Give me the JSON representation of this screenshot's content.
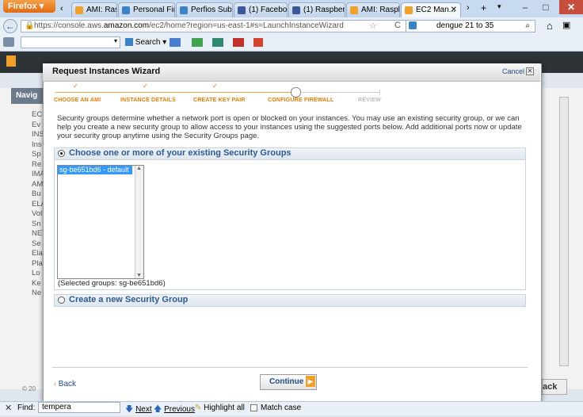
{
  "browser": {
    "menu_button": "Firefox",
    "tabs": [
      {
        "label": "AMI: Raspb...",
        "icon_color": "#f0a12a"
      },
      {
        "label": "Personal Fin...",
        "icon_color": "#3b83c8"
      },
      {
        "label": "Perfios Subs...",
        "icon_color": "#3b83c8"
      },
      {
        "label": "(1) Facebook",
        "icon_color": "#3b5998"
      },
      {
        "label": "(1) Raspberr...",
        "icon_color": "#3b5998"
      },
      {
        "label": "AMI: Raspb...",
        "icon_color": "#f0a12a"
      },
      {
        "label": "EC2 Man...",
        "icon_color": "#f0a12a"
      }
    ],
    "url_prefix": "https://console.aws.",
    "url_domain": "amazon.com",
    "url_rest": "/ec2/home?region=us-east-1#s=LaunchInstanceWizard",
    "search_text": "dengue 21 to 35",
    "toolbar_search": "Search"
  },
  "page": {
    "nav_heading": "Navig",
    "left_items": [
      "EC",
      "Ev",
      "INS",
      "Ins",
      "Sp",
      "Re",
      "IMA",
      "AM",
      "Bu",
      "ELA",
      "Vol",
      "Sn",
      "NET",
      "Se",
      "Ela",
      "Pla",
      "Lo",
      "Ke",
      "Ne"
    ],
    "right_partial": "ack",
    "footer_partial": "© 20"
  },
  "wizard": {
    "title": "Request Instances Wizard",
    "cancel": "Cancel",
    "steps": [
      {
        "label": "CHOOSE AN AMI",
        "done": true
      },
      {
        "label": "INSTANCE DETAILS",
        "done": true
      },
      {
        "label": "CREATE KEY PAIR",
        "done": true
      },
      {
        "label": "CONFIGURE FIREWALL",
        "current": true
      },
      {
        "label": "REVIEW",
        "future": true
      }
    ],
    "intro": "Security groups determine whether a network port is open or blocked on your instances. You may use an existing security group, or we can help you create a new security group to allow access to your instances using the suggested ports below. Add additional ports now or update your security group anytime using the Security Groups page.",
    "option_existing": "Choose one or more of your existing Security Groups",
    "option_new": "Create a new Security Group",
    "groups": [
      "sg-be651bd6 - default"
    ],
    "selected_text": "(Selected groups: sg-be651bd6)",
    "back": "Back",
    "continue": "Continue"
  },
  "findbar": {
    "label": "Find:",
    "query": "tempera",
    "next": "Next",
    "previous": "Previous",
    "highlight": "Highlight all",
    "match_case": "Match case"
  }
}
